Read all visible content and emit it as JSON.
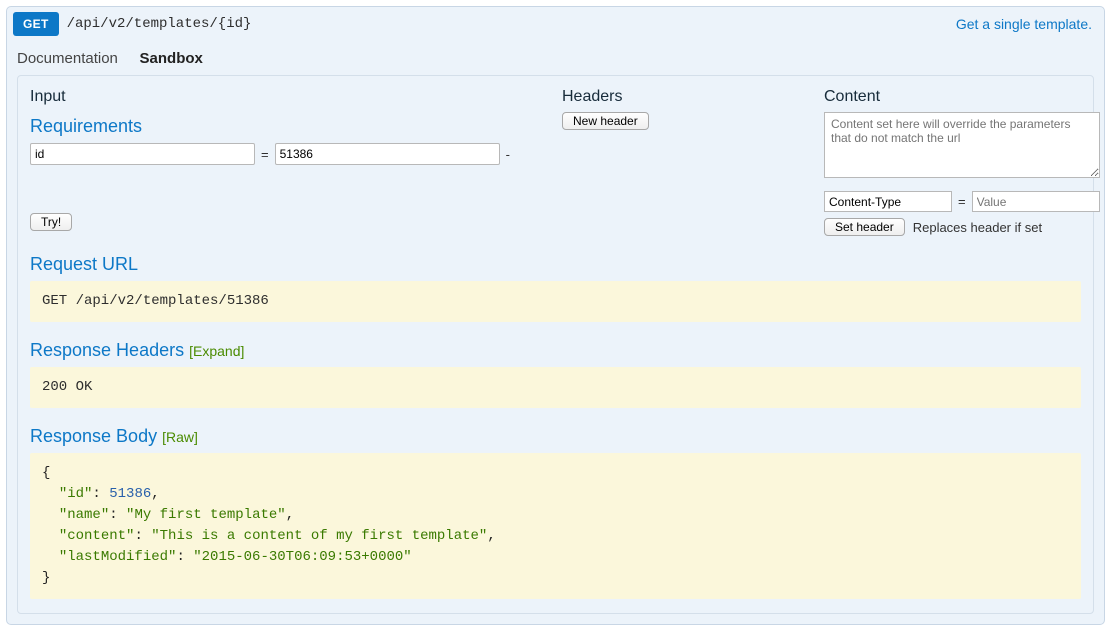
{
  "method": "GET",
  "path": "/api/v2/templates/{id}",
  "summary": "Get a single template.",
  "tabs": {
    "doc": "Documentation",
    "sandbox": "Sandbox"
  },
  "labels": {
    "input": "Input",
    "headers": "Headers",
    "content": "Content",
    "requirements": "Requirements",
    "new_header": "New header",
    "content_placeholder": "Content set here will override the parameters that do not match the url",
    "set_header": "Set header",
    "set_header_note": "Replaces header if set",
    "try": "Try!",
    "request_url": "Request URL",
    "response_headers": "Response Headers",
    "expand": "[Expand]",
    "response_body": "Response Body",
    "raw": "[Raw]"
  },
  "param": {
    "name": "id",
    "value": "51386"
  },
  "content_type": {
    "name": "Content-Type",
    "value_placeholder": "Value"
  },
  "request_url_text": "GET /api/v2/templates/51386",
  "response_status": "200 OK",
  "response_body": {
    "id": 51386,
    "name": "My first template",
    "content": "This is a content of my first template",
    "lastModified": "2015-06-30T06:09:53+0000"
  }
}
